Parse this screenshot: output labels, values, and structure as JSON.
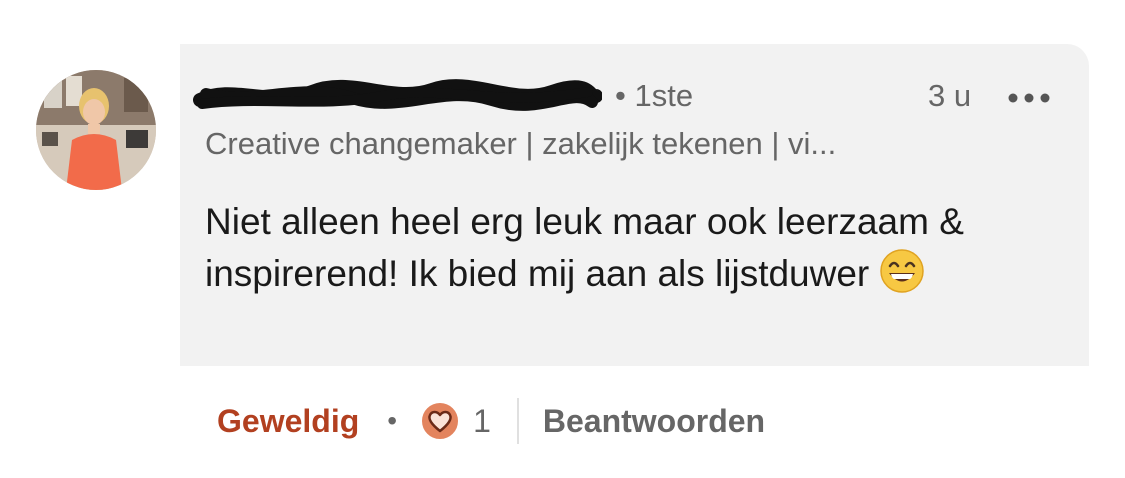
{
  "comment": {
    "author_degree": "• 1ste",
    "timestamp": "3 u",
    "headline": "Creative changemaker | zakelijk tekenen | vi...",
    "text_line1": "Niet alleen heel erg leuk maar ook leerzaam &",
    "text_line2": "inspirerend!  Ik bied mij aan als lijstduwer",
    "emoji": "grinning-face-smiling-eyes"
  },
  "actions": {
    "react_label": "Geweldig",
    "separator": "•",
    "reaction_count": "1",
    "reply_label": "Beantwoorden"
  },
  "icons": {
    "more": "more-horizontal-icon",
    "reaction": "heart-love-icon"
  },
  "colors": {
    "bubble_bg": "#f2f2f2",
    "react_accent": "#b24020",
    "reaction_badge": "#e3845e",
    "text_primary": "#1a1a1a",
    "text_secondary": "#666666"
  }
}
